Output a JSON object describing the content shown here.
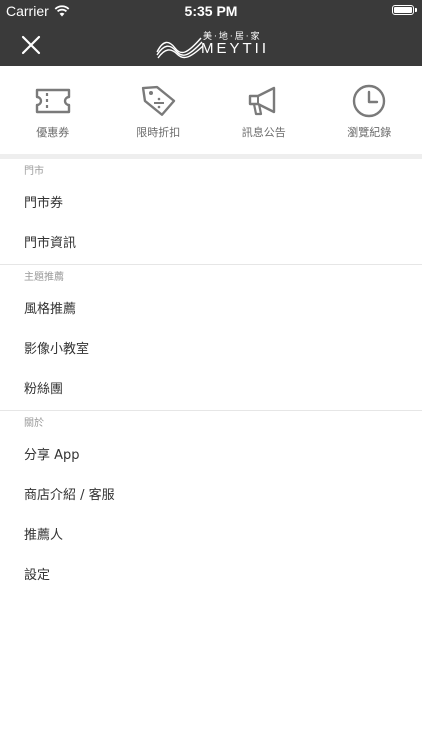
{
  "status_bar": {
    "carrier": "Carrier",
    "time": "5:35 PM"
  },
  "header": {
    "close_icon": "close-icon",
    "logo_chinese": "美·地·居·家",
    "logo_english": "MEYTII"
  },
  "quick_actions": [
    {
      "label": "優惠券",
      "icon": "ticket-icon"
    },
    {
      "label": "限時折扣",
      "icon": "price-tag-icon"
    },
    {
      "label": "訊息公告",
      "icon": "megaphone-icon"
    },
    {
      "label": "瀏覽紀錄",
      "icon": "clock-icon"
    }
  ],
  "sections": [
    {
      "title": "門市",
      "items": [
        "門市券",
        "門市資訊"
      ]
    },
    {
      "title": "主題推薦",
      "items": [
        "風格推薦",
        "影像小教室",
        "粉絲團"
      ]
    },
    {
      "title": "關於",
      "items": [
        "分享 App",
        "商店介紹 / 客服",
        "推薦人",
        "設定"
      ]
    }
  ],
  "colors": {
    "header_bg": "#3a3a3a",
    "icon_gray": "#7a7a7a",
    "text": "#333333",
    "section_title": "#9a9a9a"
  }
}
